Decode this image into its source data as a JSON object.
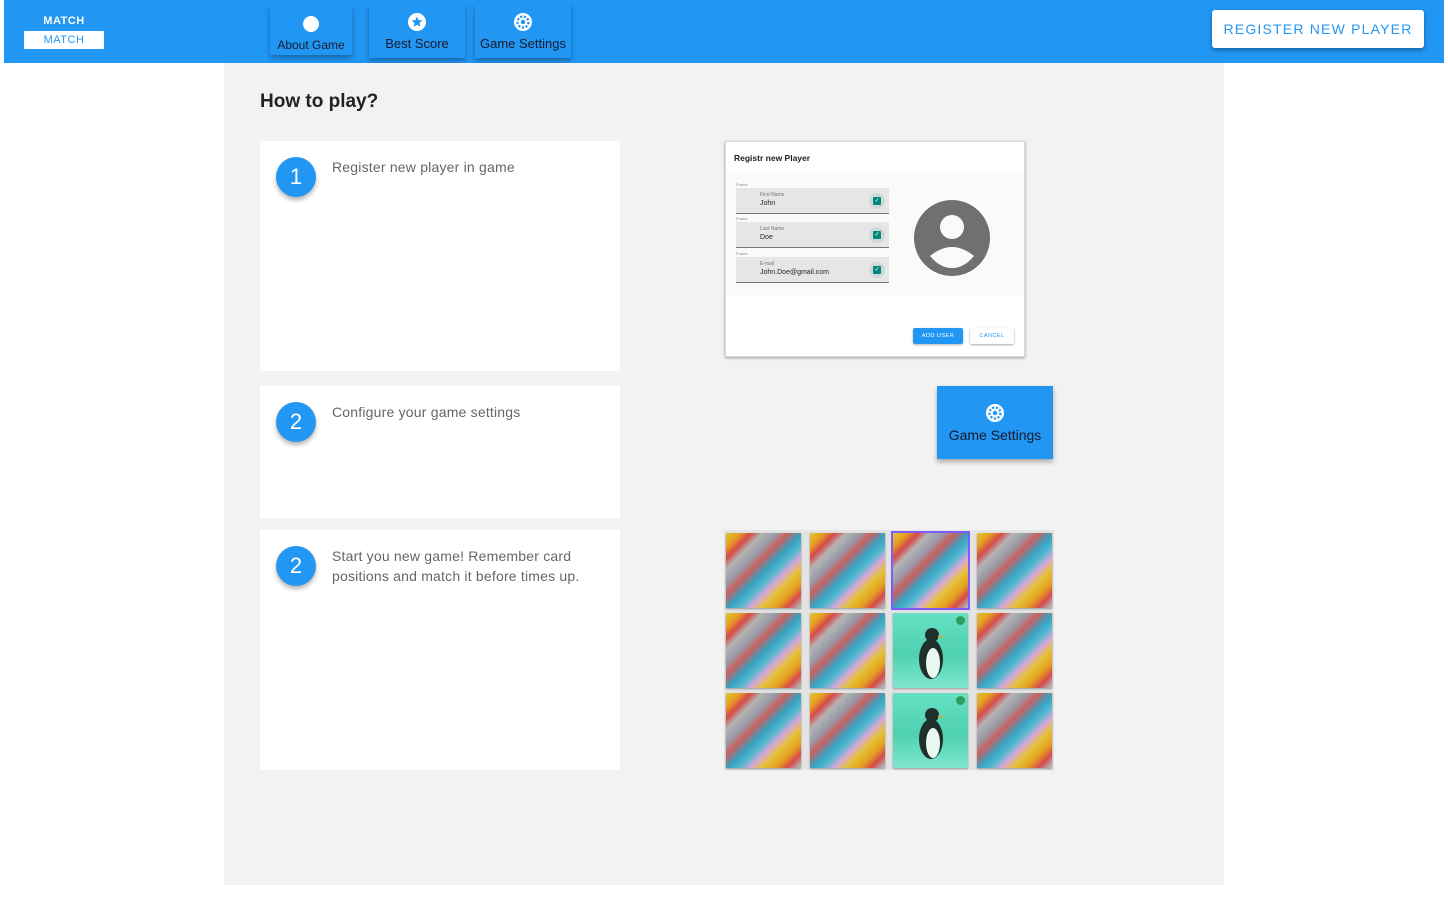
{
  "header": {
    "logo": {
      "line1": "MATCH",
      "line2": "MATCH"
    },
    "nav": [
      {
        "id": "about",
        "label": "About Game",
        "icon": "circle-icon"
      },
      {
        "id": "score",
        "label": "Best Score",
        "icon": "star-badge-icon"
      },
      {
        "id": "settings",
        "label": "Game Settings",
        "icon": "gear-icon"
      }
    ],
    "register_label": "REGISTER NEW PLAYER"
  },
  "main": {
    "title": "How to play?",
    "steps": [
      {
        "num": "1",
        "text": "Register new player in game"
      },
      {
        "num": "2",
        "text": "Configure your game settings"
      },
      {
        "num": "2",
        "text": "Start you new game! Remember card positions and match it before times up."
      }
    ],
    "register_preview": {
      "title": "Registr new Player",
      "fields": [
        {
          "caption": "Frame",
          "label": "First Name",
          "value": "John"
        },
        {
          "caption": "Frame",
          "label": "Last Name",
          "value": "Doe"
        },
        {
          "caption": "Frame",
          "label": "E-mail",
          "value": "John.Doe@gmail.com"
        }
      ],
      "add_label": "ADD USER",
      "cancel_label": "CANCEL"
    },
    "settings_preview": {
      "label": "Game Settings",
      "icon": "gear-icon"
    },
    "board": {
      "rows": 3,
      "cols": 4,
      "open_cards": [
        6,
        10
      ],
      "selected_card": 2
    }
  },
  "colors": {
    "primary": "#2196f3",
    "content_bg": "#f2f2f2",
    "card_open": "#4fd1b0"
  }
}
